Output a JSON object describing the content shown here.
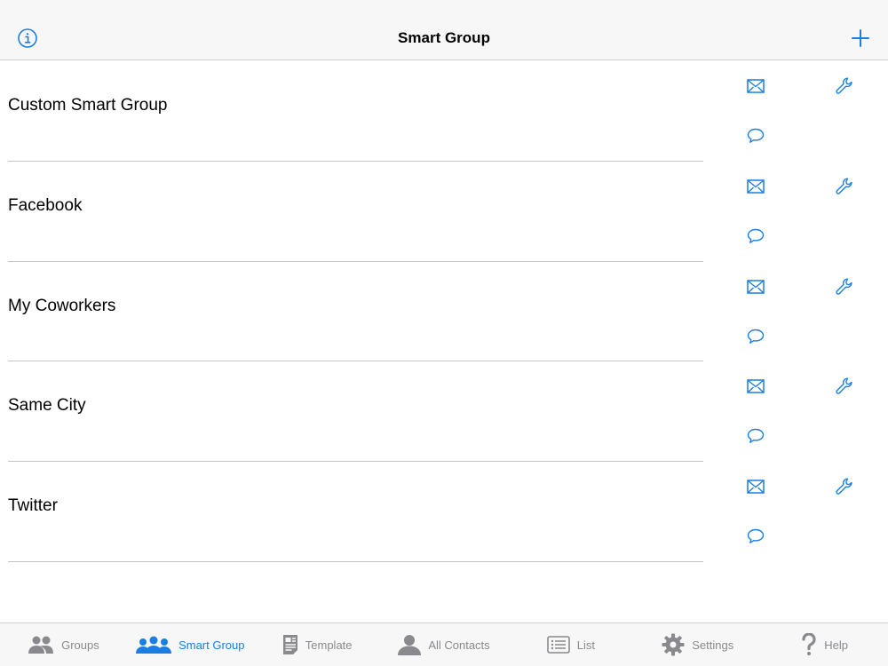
{
  "header": {
    "title": "Smart Group"
  },
  "groups": [
    {
      "label": "Custom Smart Group"
    },
    {
      "label": "Facebook"
    },
    {
      "label": "My Coworkers"
    },
    {
      "label": "Same City"
    },
    {
      "label": "Twitter"
    }
  ],
  "tabs": [
    {
      "label": "Groups",
      "icon": "groups-icon"
    },
    {
      "label": "Smart Group",
      "icon": "smart-group-icon"
    },
    {
      "label": "Template",
      "icon": "template-icon"
    },
    {
      "label": "All Contacts",
      "icon": "person-icon"
    },
    {
      "label": "List",
      "icon": "list-icon"
    },
    {
      "label": "Settings",
      "icon": "gear-icon"
    },
    {
      "label": "Help",
      "icon": "question-icon"
    }
  ],
  "colors": {
    "accent": "#1a7ee3",
    "inactive": "#8a8a8e",
    "bar": "#f7f7f7"
  }
}
